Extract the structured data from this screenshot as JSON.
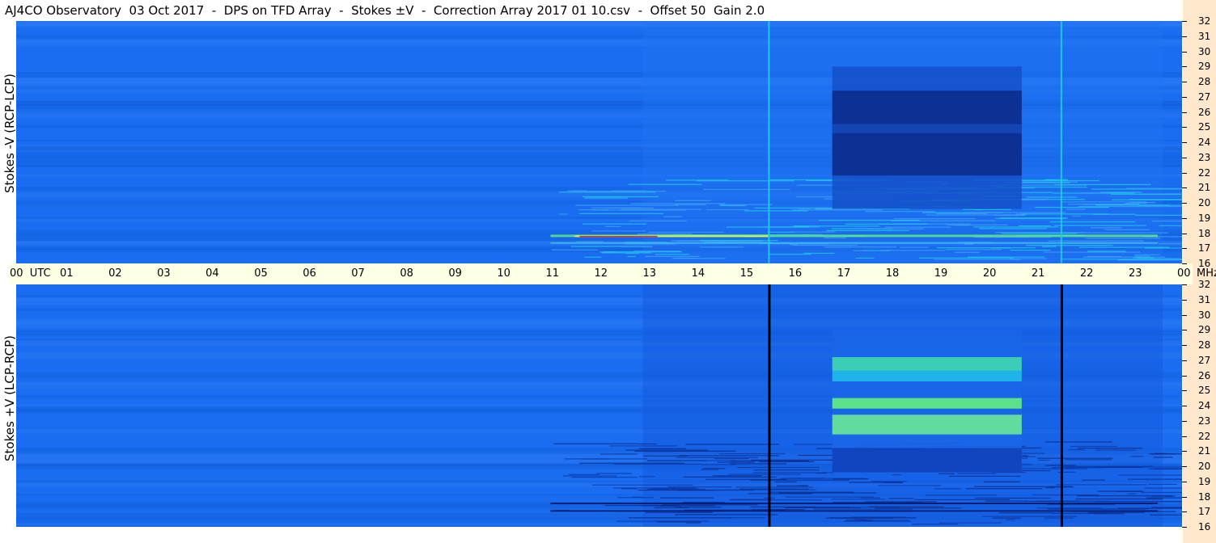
{
  "title": "AJ4CO Observatory  03 Oct 2017  -  DPS on TFD Array  -  Stokes ±V  -  Correction Array 2017 01 10.csv  -  Offset 50  Gain 2.0",
  "panels": [
    {
      "label": "Stokes -V (RCP-LCP)"
    },
    {
      "label": "Stokes +V (LCP-RCP)"
    }
  ],
  "colors": {
    "background_blue": "#1a6cf0",
    "dark_blue": "#0a2a8a",
    "cyan": "#20c8e8",
    "green": "#60f080",
    "yellow": "#f0f040",
    "red": "#e02020",
    "axis_bg": "#ffffe6",
    "freq_strip_bg": "#ffe8cc"
  },
  "chart_data": [
    {
      "type": "heatmap",
      "title": "AJ4CO Observatory  03 Oct 2017  -  DPS on TFD Array  -  Stokes ±V  -  Correction Array 2017 01 10.csv  -  Offset 50  Gain 2.0",
      "ylabel": "Stokes -V (RCP-LCP)",
      "x_ticks": [
        "00  UTC",
        "01",
        "02",
        "03",
        "04",
        "05",
        "06",
        "07",
        "08",
        "09",
        "10",
        "11",
        "12",
        "13",
        "14",
        "15",
        "16",
        "17",
        "18",
        "19",
        "20",
        "21",
        "22",
        "23",
        "00"
      ],
      "x_unit": "UTC",
      "xlim": [
        0,
        24
      ],
      "y_ticks": [
        "16",
        "17",
        "18",
        "19",
        "20",
        "21",
        "22",
        "23",
        "24",
        "25",
        "26",
        "27",
        "28",
        "29",
        "30",
        "31",
        "32"
      ],
      "y_unit": "MHz",
      "ylim": [
        16,
        32
      ]
    },
    {
      "type": "heatmap",
      "ylabel": "Stokes +V (LCP-RCP)",
      "x_ticks": [
        "00  UTC",
        "01",
        "02",
        "03",
        "04",
        "05",
        "06",
        "07",
        "08",
        "09",
        "10",
        "11",
        "12",
        "13",
        "14",
        "15",
        "16",
        "17",
        "18",
        "19",
        "20",
        "21",
        "22",
        "23",
        "00"
      ],
      "x_unit": "UTC",
      "xlim": [
        0,
        24
      ],
      "y_ticks": [
        "16",
        "17",
        "18",
        "19",
        "20",
        "21",
        "22",
        "23",
        "24",
        "25",
        "26",
        "27",
        "28",
        "29",
        "30",
        "31",
        "32"
      ],
      "y_unit": "MHz",
      "ylim": [
        16,
        32
      ]
    }
  ],
  "axis": {
    "time_labels": [
      "00  UTC",
      "01",
      "02",
      "03",
      "04",
      "05",
      "06",
      "07",
      "08",
      "09",
      "10",
      "11",
      "12",
      "13",
      "14",
      "15",
      "16",
      "17",
      "18",
      "19",
      "20",
      "21",
      "22",
      "23",
      "00"
    ],
    "unit": "MHz",
    "freq_labels": [
      "32",
      "31",
      "30",
      "29",
      "28",
      "27",
      "26",
      "25",
      "24",
      "23",
      "22",
      "21",
      "20",
      "19",
      "18",
      "17",
      "16"
    ]
  }
}
